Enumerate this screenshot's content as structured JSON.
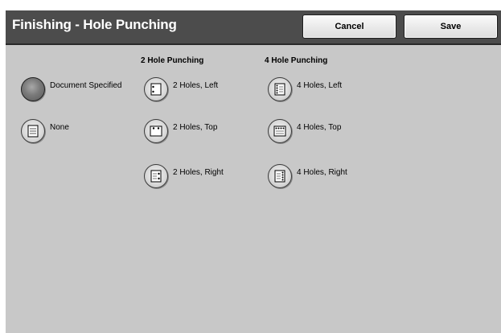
{
  "header": {
    "title": "Finishing - Hole Punching",
    "cancel_label": "Cancel",
    "save_label": "Save"
  },
  "columns": {
    "two_hole_header": "2 Hole Punching",
    "four_hole_header": "4 Hole Punching"
  },
  "options": {
    "document_specified": "Document Specified",
    "none": "None",
    "two_left": "2 Holes, Left",
    "two_top": "2 Holes, Top",
    "two_right": "2 Holes, Right",
    "four_left": "4 Holes, Left",
    "four_top": "4 Holes, Top",
    "four_right": "4 Holes, Right"
  },
  "selected_option": "Document Specified",
  "icons": {
    "document_specified": "selected-radio",
    "none": "plain-page-icon",
    "two_left": "page-2-holes-left-icon",
    "two_top": "page-2-holes-top-icon",
    "two_right": "page-2-holes-right-icon",
    "four_left": "page-4-holes-left-icon",
    "four_top": "page-4-holes-top-icon",
    "four_right": "page-4-holes-right-icon"
  }
}
